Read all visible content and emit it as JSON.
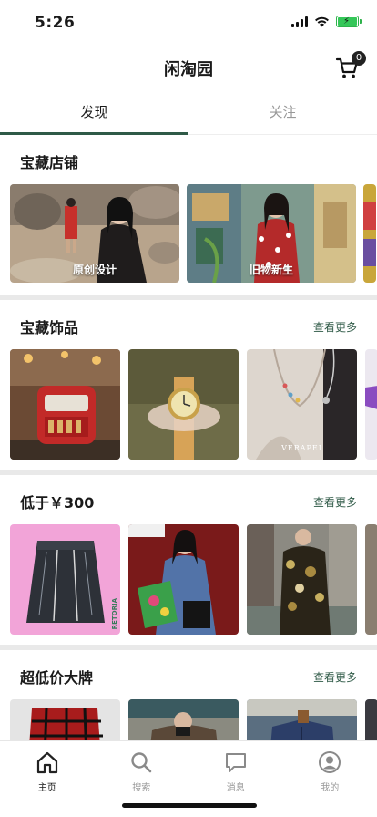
{
  "status": {
    "time": "5:26"
  },
  "header": {
    "title": "闲淘园",
    "cart_count": "0"
  },
  "tabs": [
    {
      "label": "发现",
      "active": true
    },
    {
      "label": "关注",
      "active": false
    }
  ],
  "sections": {
    "shops": {
      "title": "宝藏店铺",
      "cards": [
        {
          "label": "原创设计"
        },
        {
          "label": "旧物新生"
        }
      ]
    },
    "accessories": {
      "title": "宝藏饰品",
      "more": "查看更多",
      "watermark": "VERAPEI"
    },
    "under300": {
      "title": "低于￥300",
      "more": "查看更多",
      "side_text": "RETORIA"
    },
    "brands": {
      "title": "超低价大牌",
      "more": "查看更多"
    }
  },
  "bottom_nav": [
    {
      "label": "主页",
      "icon": "home-icon",
      "active": true
    },
    {
      "label": "搜索",
      "icon": "search-icon",
      "active": false
    },
    {
      "label": "消息",
      "icon": "message-icon",
      "active": false
    },
    {
      "label": "我的",
      "icon": "profile-icon",
      "active": false
    }
  ],
  "colors": {
    "accent": "#2f5a47",
    "battery": "#35c759"
  }
}
